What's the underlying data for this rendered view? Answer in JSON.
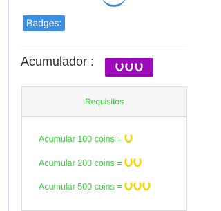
{
  "header": {
    "badges_label": "Badges:"
  },
  "acumulador": {
    "label": "Acumulador :",
    "badge_count": 3,
    "badge_icon": "horseshoe-icon",
    "badge_bg": "#9b0bb7",
    "badge_icon_color": "#ffffff"
  },
  "requisitos": {
    "title": "Requisitos",
    "title_color": "#2ecc2e",
    "icon": "horseshoe-icon",
    "icon_color": "#f2d600",
    "items": [
      {
        "text": "Acumular 100 coins =",
        "icon_count": 1
      },
      {
        "text": "Acumular 200 coins =",
        "icon_count": 2
      },
      {
        "text": "Acumular 500 coins =",
        "icon_count": 3
      }
    ]
  },
  "colors": {
    "accent_blue": "#3f8fe0",
    "text_green": "#38cf38"
  }
}
